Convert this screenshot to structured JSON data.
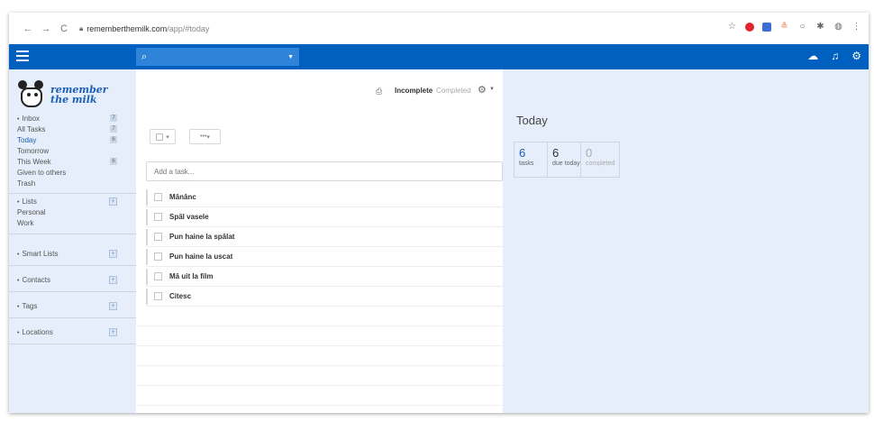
{
  "browser": {
    "back_icon": "←",
    "forward_icon": "→",
    "reload_icon": "C",
    "url_host": "rememberthemilk.com",
    "url_path": "/app/#today"
  },
  "search": {
    "placeholder": ""
  },
  "logo": {
    "line1": "remember",
    "line2": "the milk"
  },
  "sidebar": {
    "inbox": {
      "label": "Inbox",
      "items": [
        {
          "label": "All Tasks",
          "count": "7"
        },
        {
          "label": "Today",
          "count": "6"
        },
        {
          "label": "Tomorrow",
          "count": ""
        },
        {
          "label": "This Week",
          "count": "6"
        },
        {
          "label": "Given to others",
          "count": ""
        },
        {
          "label": "Trash",
          "count": ""
        }
      ],
      "count": "7"
    },
    "lists": {
      "label": "Lists",
      "items": [
        "Personal",
        "Work"
      ]
    },
    "smart_lists": {
      "label": "Smart Lists"
    },
    "contacts": {
      "label": "Contacts"
    },
    "tags": {
      "label": "Tags"
    },
    "locations": {
      "label": "Locations"
    }
  },
  "main": {
    "tab_incomplete": "Incomplete",
    "tab_completed": "Completed",
    "add_task_placeholder": "Add a task...",
    "more_label": "•••",
    "tasks": [
      "Mănânc",
      "Spăl vasele",
      "Pun haine la spălat",
      "Pun haine la uscat",
      "Mă uit la film",
      "Citesc"
    ]
  },
  "summary": {
    "title": "Today",
    "tasks_num": "6",
    "tasks_cap": "tasks",
    "due_num": "6",
    "due_cap": "due today",
    "done_num": "0",
    "done_cap": "completed"
  },
  "colors": {
    "brand": "#0060bf",
    "sidebar_bg": "#e5eefa"
  }
}
